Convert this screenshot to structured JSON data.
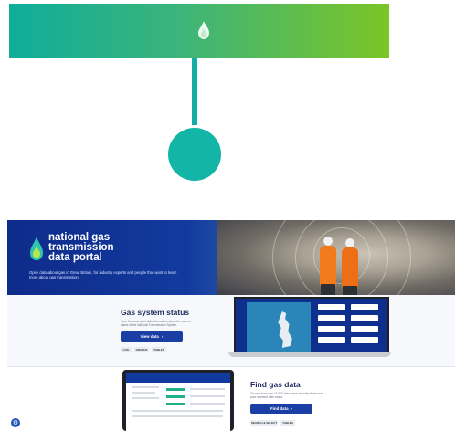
{
  "banner": {
    "icon": "flame-icon",
    "gradient_start": "#0fad9a",
    "gradient_end": "#7cc427"
  },
  "connector_color": "#12b0a4",
  "node_color": "#12b5a6",
  "portal": {
    "logo_line1": "national gas",
    "logo_line2": "transmission",
    "logo_line3": "data portal",
    "tagline": "Open data about gas in Great Britain, for industry experts and people that want to learn more about gas transmission.",
    "section1": {
      "title": "Gas system status",
      "description": "View the most up to date information about the current status of the National Transmission System.",
      "button": "View data",
      "tags": [
        "LIVE",
        "GRAPHS",
        "TABLES"
      ]
    },
    "section2": {
      "title": "Find gas data",
      "description": "Choose from over 11,000 data items and view them over your selected date range.",
      "button": "Find data",
      "tags": [
        "SEARCH & SELECT",
        "TABLES"
      ]
    }
  },
  "corner_icon": "settings-icon"
}
